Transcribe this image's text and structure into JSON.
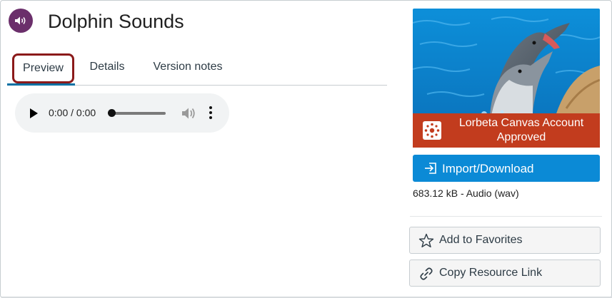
{
  "resource": {
    "title": "Dolphin Sounds",
    "badge_icon": "speaker-icon",
    "badge_color": "#6b2f6b"
  },
  "tabs": [
    {
      "label": "Preview",
      "active": true
    },
    {
      "label": "Details",
      "active": false
    },
    {
      "label": "Version notes",
      "active": false
    }
  ],
  "player": {
    "time": "0:00 / 0:00",
    "play_icon": "play-icon",
    "volume_icon": "volume-icon",
    "menu_icon": "more-vertical-icon"
  },
  "sidebar": {
    "approval_label": "Lorbeta Canvas Account Approved",
    "approval_color": "#c23c1e",
    "import_label": "Import/Download",
    "import_color": "#0b8ad6",
    "file_info": "683.12 kB - Audio (wav)",
    "favorites_label": "Add to Favorites",
    "copy_link_label": "Copy Resource Link"
  }
}
